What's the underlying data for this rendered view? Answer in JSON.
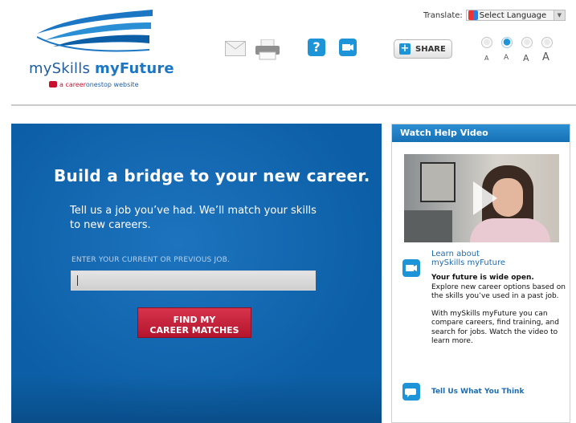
{
  "header": {
    "logo_text_light": "mySkills",
    "logo_text_bold": "myFuture",
    "logo_sub_red": "a career",
    "logo_sub_blue": "onestop website",
    "translate_label": "Translate:",
    "select_language": "Select Language",
    "share_label": "SHARE",
    "font_size_labels": [
      "A",
      "A",
      "A",
      "A"
    ],
    "selected_font_size": 2
  },
  "main": {
    "headline": "Build a bridge to your new career.",
    "intro": "Tell us a job you’ve had. We’ll match your skills to new careers.",
    "job_label": "ENTER YOUR CURRENT OR PREVIOUS JOB.",
    "job_input_value": "",
    "find_button_line1": "FIND MY",
    "find_button_line2": "CAREER MATCHES"
  },
  "help": {
    "header": "Watch Help Video",
    "learn_title_line1": "Learn about",
    "learn_title_line2": "mySkills myFuture",
    "learn_lead_bold": "Your future is wide open.",
    "learn_lead_rest": "Explore new career options based on the skills you’ve used in a past job.",
    "learn_body": "With mySkills myFuture you can compare careers, find training, and search for jobs. Watch the video to learn more.",
    "feedback_link": "Tell Us What You Think"
  },
  "colors": {
    "brand_blue": "#0c5fa6",
    "accent_blue": "#1e94d8",
    "button_red": "#c8102e"
  }
}
